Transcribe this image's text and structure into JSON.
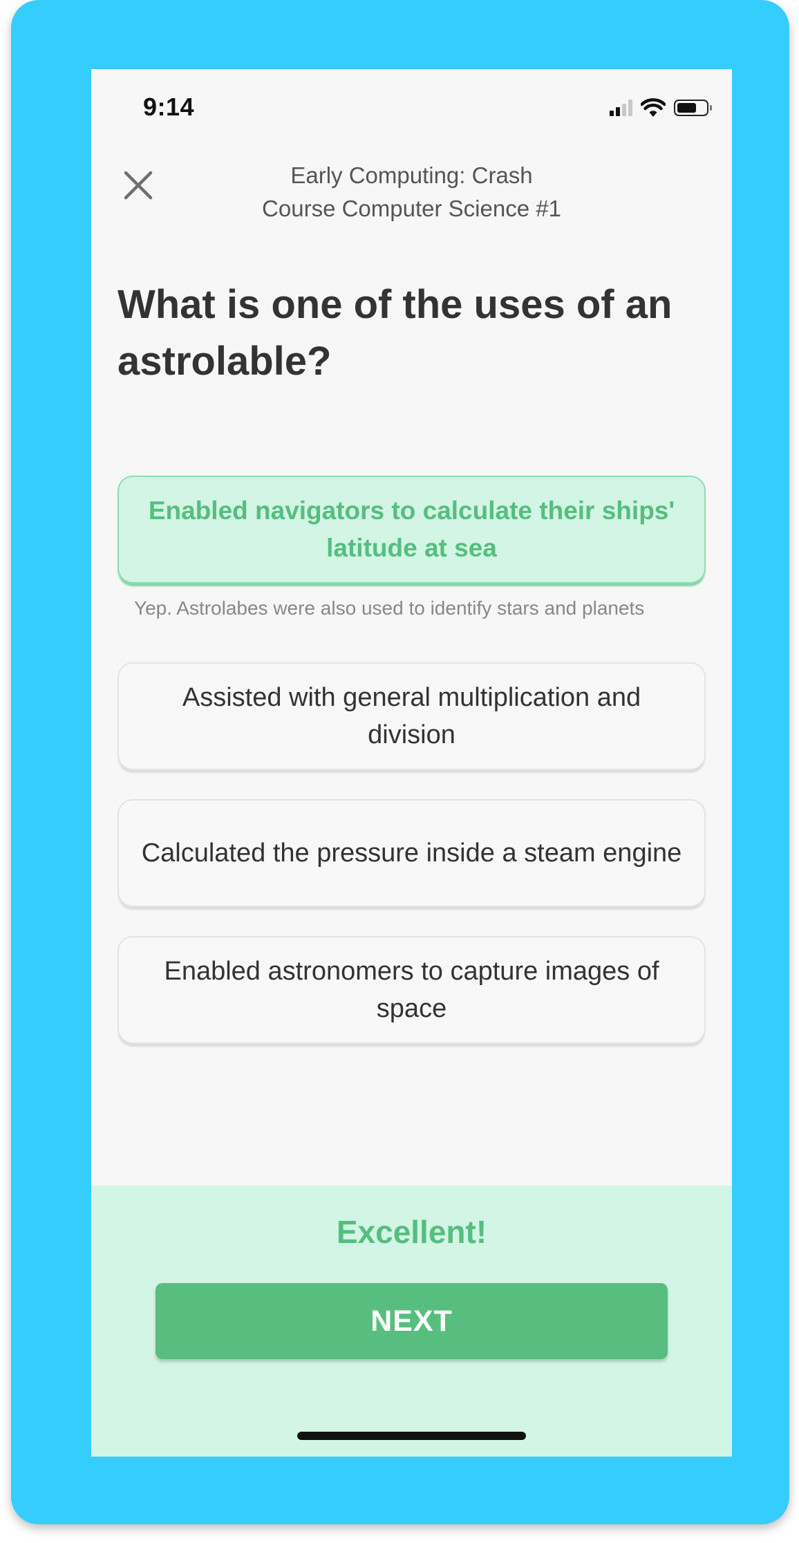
{
  "status_bar": {
    "time": "9:14",
    "icons": [
      "cellular-signal-icon",
      "wifi-icon",
      "battery-icon"
    ]
  },
  "header": {
    "close_icon": "close-icon",
    "title_line1": "Early Computing: Crash",
    "title_line2": "Course Computer Science #1"
  },
  "question": {
    "text": "What is one of the uses of an astrolable?"
  },
  "options": [
    {
      "text": "Enabled navigators to calculate their ships' latitude at sea",
      "state": "correct-selected",
      "explanation": "Yep. Astrolabes were also used to identify stars and planets"
    },
    {
      "text": "Assisted with general multiplication and division",
      "state": "unselected"
    },
    {
      "text": "Calculated the pressure inside a steam engine",
      "state": "unselected"
    },
    {
      "text": "Enabled astronomers to capture images of space",
      "state": "unselected"
    }
  ],
  "footer": {
    "feedback": "Excellent!",
    "next_label": "NEXT"
  },
  "colors": {
    "frame_background": "#35cdfd",
    "screen_background": "#f7f7f7",
    "success_green": "#58be80",
    "success_light": "#d2f5e5"
  }
}
